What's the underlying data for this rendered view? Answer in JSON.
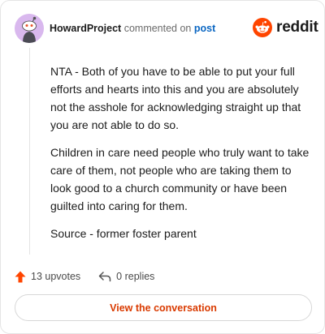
{
  "header": {
    "username": "HowardProject",
    "action_text": "commented on",
    "post_link": "post"
  },
  "brand": {
    "wordmark": "reddit",
    "color": "#ff4500"
  },
  "comment": {
    "paragraphs": [
      "NTA - Both of you have to be able to put your full efforts and hearts into this and you are absolutely not the asshole for acknowledging straight up that you are not able to do so.",
      "Children in care need people who truly want to take care of them, not people who are taking them to look good to a church community or have been guilted into caring for them.",
      "Source - former foster parent"
    ]
  },
  "actions": {
    "upvotes_label": "13 upvotes",
    "replies_label": "0 replies",
    "upvote_color": "#ff4500"
  },
  "cta": {
    "label": "View the conversation",
    "color": "#d93a00"
  },
  "colors": {
    "avatar_bg": "#d9b8ee",
    "link": "#0a66c2"
  }
}
